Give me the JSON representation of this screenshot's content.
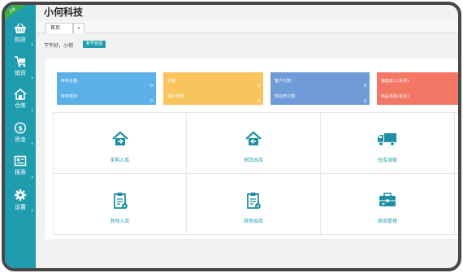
{
  "app": {
    "title": "小何科技",
    "corner_badge": "正版"
  },
  "sidebar": {
    "items": [
      {
        "label": "购货",
        "icon": "basket-icon"
      },
      {
        "label": "销货",
        "icon": "cart-icon"
      },
      {
        "label": "仓库",
        "icon": "warehouse-icon"
      },
      {
        "label": "资金",
        "icon": "money-icon"
      },
      {
        "label": "报表",
        "icon": "report-icon"
      },
      {
        "label": "设置",
        "icon": "gear-icon"
      }
    ],
    "arrow": "›"
  },
  "tabs": {
    "active": "首页",
    "dropdown": "▾"
  },
  "header": {
    "greeting": "下午好，小何",
    "account_button": "账号管理"
  },
  "stats": [
    {
      "color": "#5bb0e8",
      "lines": [
        {
          "label": "库存总量:",
          "value": "0"
        },
        {
          "label": "库存成本:",
          "value": "0"
        }
      ]
    },
    {
      "color": "#f8c45c",
      "lines": [
        {
          "label": "现金:",
          "value": "0"
        },
        {
          "label": "银行存款:",
          "value": "0"
        }
      ]
    },
    {
      "color": "#6f9bd8",
      "lines": [
        {
          "label": "客户欠款:",
          "value": "0"
        },
        {
          "label": "供应商欠款:",
          "value": "0"
        }
      ]
    },
    {
      "color": "#f47766",
      "lines": [
        {
          "label": "销售收入(本月):",
          "value": ""
        },
        {
          "label": "商品毛利(本月):",
          "value": ""
        }
      ]
    }
  ],
  "shortcuts": [
    {
      "label": "采购入库",
      "icon": "house-arrow-in-icon"
    },
    {
      "label": "销货出库",
      "icon": "house-arrow-out-icon"
    },
    {
      "label": "仓库调拨",
      "icon": "truck-icon"
    },
    {
      "label": "其他入库",
      "icon": "clipboard-in-icon"
    },
    {
      "label": "其他出库",
      "icon": "clipboard-out-icon"
    },
    {
      "label": "商品管理",
      "icon": "product-icon"
    }
  ]
}
